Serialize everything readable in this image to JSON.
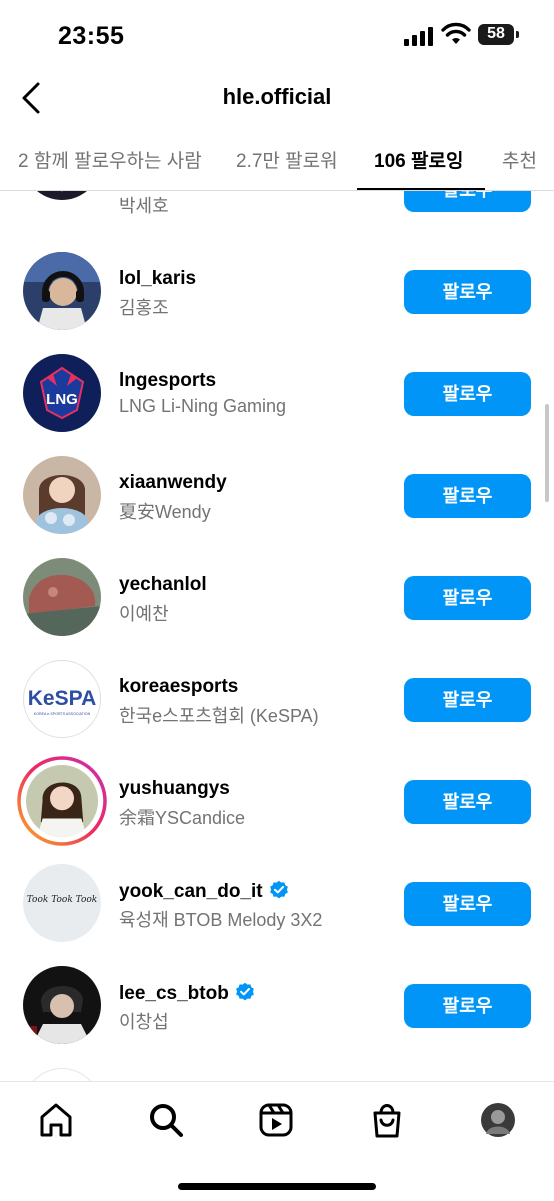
{
  "status_bar": {
    "time": "23:55",
    "battery": "58"
  },
  "header": {
    "title": "hle.official"
  },
  "tabs": [
    {
      "label": "2 함께 팔로우하는 사람"
    },
    {
      "label": "2.7만 팔로워"
    },
    {
      "label": "106 팔로잉"
    },
    {
      "label": "추천"
    }
  ],
  "follow_label": "팔로우",
  "rows": [
    {
      "username": "",
      "fullname": "박세호",
      "verified": false,
      "avatar": "suit-person"
    },
    {
      "username": "lol_karis",
      "fullname": "김홍조",
      "verified": false,
      "avatar": "headset-player"
    },
    {
      "username": "lngesports",
      "fullname": "LNG Li-Ning Gaming",
      "verified": false,
      "avatar": "lng-logo"
    },
    {
      "username": "xiaanwendy",
      "fullname": "夏安Wendy",
      "verified": false,
      "avatar": "woman-flowers"
    },
    {
      "username": "yechanlol",
      "fullname": "이예찬",
      "verified": false,
      "avatar": "rock-photo"
    },
    {
      "username": "koreaesports",
      "fullname": "한국e스포츠협회 (KeSPA)",
      "verified": false,
      "avatar": "kespa-logo"
    },
    {
      "username": "yushuangys",
      "fullname": "余霜YSCandice",
      "verified": false,
      "avatar": "woman-story"
    },
    {
      "username": "yook_can_do_it",
      "fullname": "육성재 BTOB Melody 3X2",
      "verified": true,
      "avatar": "handwriting"
    },
    {
      "username": "lee_cs_btob",
      "fullname": "이창섭",
      "verified": true,
      "avatar": "dark-portrait"
    }
  ],
  "kespa": {
    "logo_text": "KeSPA",
    "sub_text": "KOREA e-SPORTS ASSOCIATION"
  },
  "lng": {
    "logo_text": "LNG"
  },
  "handwriting": {
    "text": "Took Took Took"
  },
  "colors": {
    "accent": "#0095f6",
    "secondary_text": "#737373"
  }
}
